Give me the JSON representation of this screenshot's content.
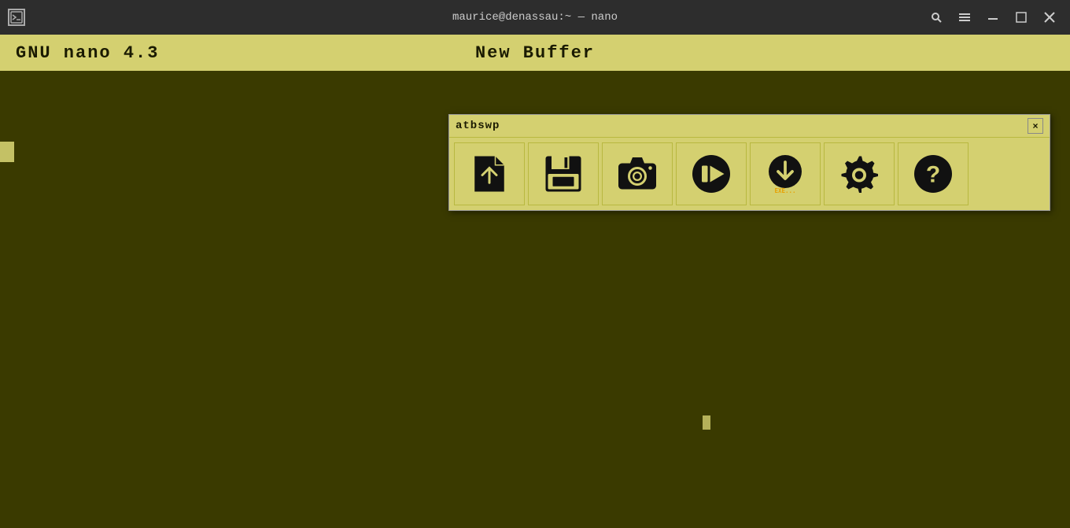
{
  "titlebar": {
    "title": "maurice@denassau:~ — nano",
    "icon_label": "↑",
    "btn_search": "🔍",
    "btn_menu": "≡",
    "btn_minimize": "—",
    "btn_maximize": "◻",
    "btn_close": "✕"
  },
  "nano_header": {
    "version": "GNU  nano  4.3",
    "buffer": "New  Buffer"
  },
  "toolbar": {
    "title": "atbswp",
    "close_btn": "×",
    "icons": [
      {
        "name": "upload-file-icon",
        "label": "Upload File",
        "interactable": true
      },
      {
        "name": "save-icon",
        "label": "Save",
        "interactable": true
      },
      {
        "name": "camera-icon",
        "label": "Camera/Record",
        "interactable": true
      },
      {
        "name": "play-stop-icon",
        "label": "Play/Stop",
        "interactable": true
      },
      {
        "name": "download-exe-icon",
        "label": "Download/Execute",
        "interactable": true
      },
      {
        "name": "settings-icon",
        "label": "Settings",
        "interactable": true
      },
      {
        "name": "help-icon",
        "label": "Help",
        "interactable": true
      }
    ]
  }
}
